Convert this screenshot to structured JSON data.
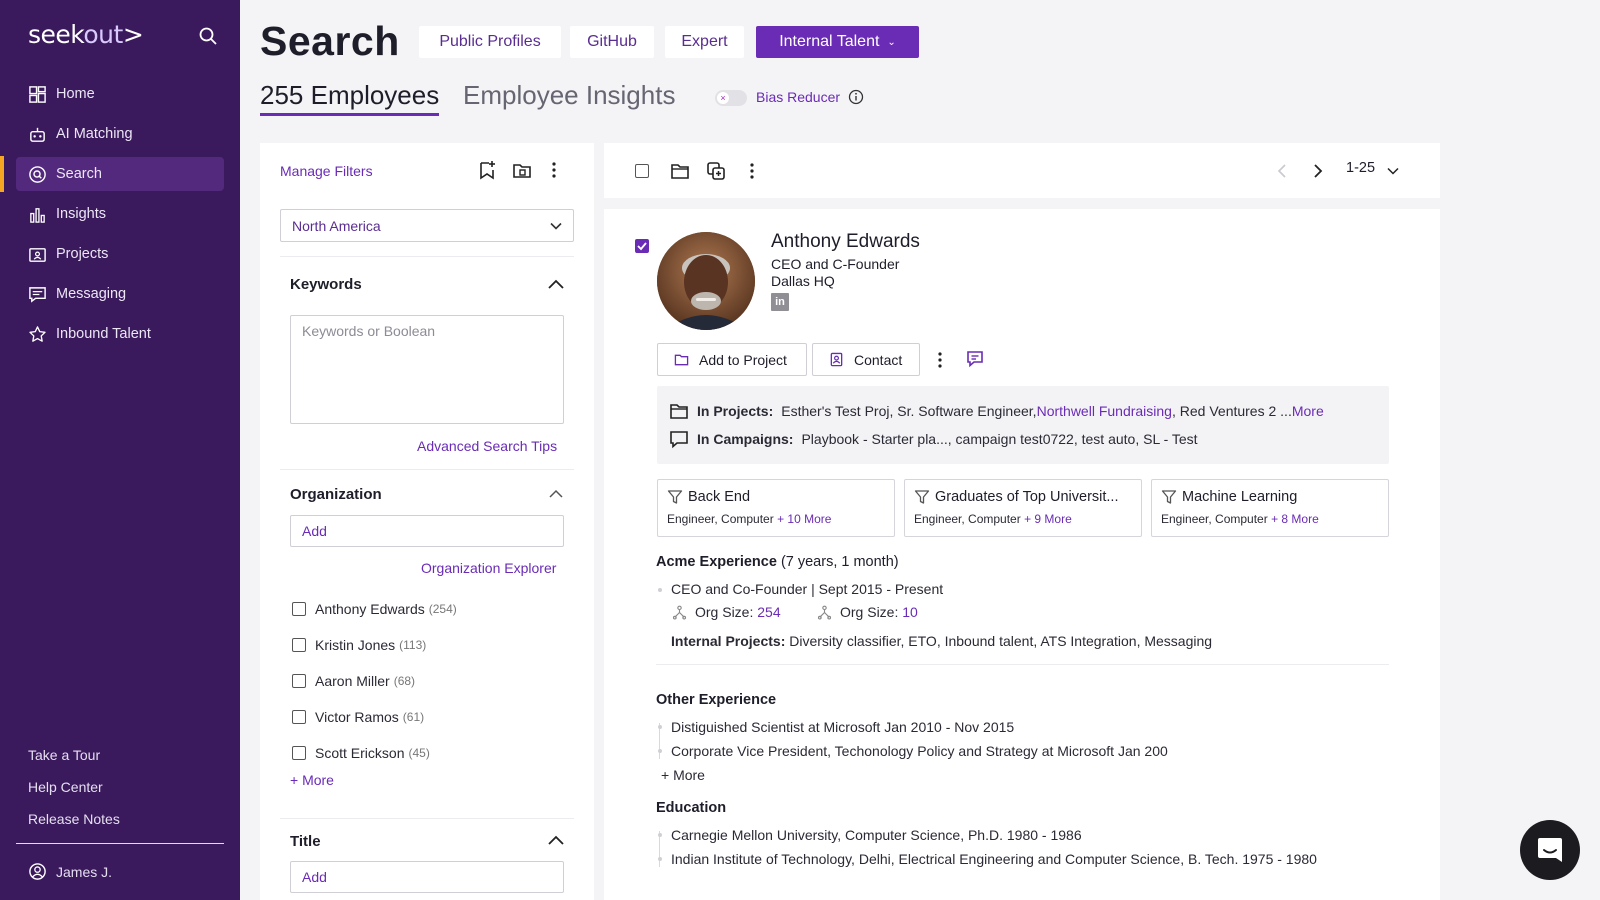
{
  "sidebar": {
    "logo_seek": "seek",
    "logo_out": "out",
    "logo_mark": ">",
    "items": [
      {
        "label": "Home",
        "icon": "grid-icon"
      },
      {
        "label": "AI Matching",
        "icon": "robot-icon"
      },
      {
        "label": "Search",
        "icon": "search-circle-icon",
        "active": true
      },
      {
        "label": "Insights",
        "icon": "bar-chart-icon"
      },
      {
        "label": "Projects",
        "icon": "folder-user-icon"
      },
      {
        "label": "Messaging",
        "icon": "message-icon"
      },
      {
        "label": "Inbound Talent",
        "icon": "star-icon"
      }
    ],
    "bottom_links": [
      "Take a Tour",
      "Help Center",
      "Release Notes"
    ],
    "user": "James J."
  },
  "header": {
    "title": "Search",
    "source_tabs": [
      "Public Profiles",
      "GitHub",
      "Expert",
      "Internal Talent"
    ],
    "subtabs": [
      "255 Employees",
      "Employee Insights"
    ],
    "bias_reducer_label": "Bias Reducer",
    "bias_reducer_on": false
  },
  "filters": {
    "manage_label": "Manage Filters",
    "region": "North America",
    "keywords": {
      "title": "Keywords",
      "placeholder": "Keywords or Boolean",
      "tips_link": "Advanced Search Tips"
    },
    "organization": {
      "title": "Organization",
      "add_placeholder": "Add",
      "explorer_link": "Organization Explorer",
      "options": [
        {
          "name": "Anthony Edwards",
          "count": "(254)"
        },
        {
          "name": "Kristin Jones",
          "count": "(113)"
        },
        {
          "name": "Aaron Miller",
          "count": "(68)"
        },
        {
          "name": "Victor Ramos",
          "count": "(61)"
        },
        {
          "name": "Scott Erickson",
          "count": "(45)"
        }
      ],
      "more_link": "+ More"
    },
    "title_section": {
      "title": "Title",
      "add_placeholder": "Add"
    }
  },
  "results": {
    "range": "1-25"
  },
  "profile": {
    "name": "Anthony Edwards",
    "title": "CEO and C-Founder",
    "location": "Dallas HQ",
    "linkedin_letters": "in",
    "add_to_project": "Add to Project",
    "contact": "Contact",
    "in_projects_label": "In Projects:",
    "in_projects_text": "Esther's Test Proj, Sr. Software Engineer, ",
    "in_projects_highlight": "Northwell Fundraising",
    "in_projects_tail": ", Red Ventures 2 ...",
    "in_projects_more": "More",
    "in_campaigns_label": "In Campaigns:",
    "in_campaigns_text": "Playbook - Starter pla..., campaign test0722, test auto, SL - Test",
    "chips": [
      {
        "title": "Back End",
        "sub": "Engineer, Computer",
        "more": "+ 10 More"
      },
      {
        "title": "Graduates of Top Universit...",
        "sub": "Engineer, Computer",
        "more": "+ 9 More"
      },
      {
        "title": "Machine Learning",
        "sub": "Engineer, Computer",
        "more": "+ 8 More"
      }
    ],
    "acme_experience_label": "Acme Experience",
    "acme_experience_duration": "(7 years, 1 month)",
    "acme_role": "CEO and Co-Founder | Sept 2015 - Present",
    "org_size_label": "Org Size:",
    "org_size_1": "254",
    "org_size_2": "10",
    "internal_projects_label": "Internal Projects:",
    "internal_projects": "Diversity classifier, ETO, Inbound talent, ATS Integration, Messaging",
    "other_experience_label": "Other Experience",
    "other_experience": [
      "Distiguished Scientist at Microsoft Jan 2010 - Nov 2015",
      "Corporate Vice President, Techonology Policy and Strategy at Microsoft Jan 200"
    ],
    "other_more": "+ More",
    "education_label": "Education",
    "education": [
      "Carnegie Mellon University, Computer Science, Ph.D. 1980 - 1986",
      "Indian Institute of Technology, Delhi, Electrical Engineering and Computer Science, B. Tech. 1975 - 1980"
    ]
  },
  "colors": {
    "sidebar_bg": "#3a1a5c",
    "accent": "#6a2bb5",
    "active_marker": "#f5a623"
  }
}
